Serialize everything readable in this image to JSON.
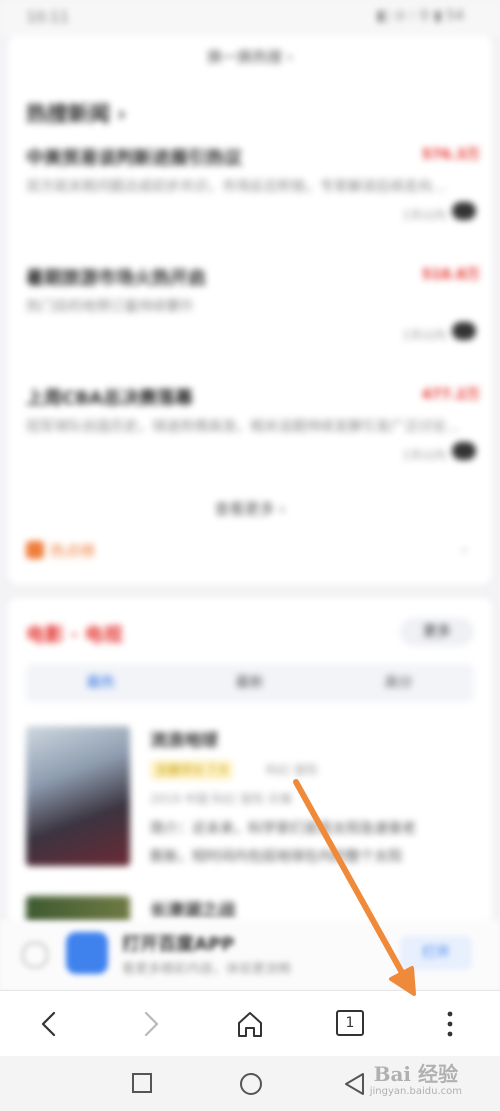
{
  "status": {
    "time": "10:11",
    "right": "◧ ⊙ ⁝ ⚲ ▮ 54"
  },
  "top_card": {
    "search_hint": "换一换热搜 ›",
    "section_title": "热搜新闻 ›",
    "news": [
      {
        "title": "中美贸易谈判新进展引热议",
        "hot": "576.3万",
        "desc": "双方就关税问题达成初步共识，市场反应积极，专家解读后续走向…",
        "meta": "1天以内"
      },
      {
        "title": "暑期旅游市场火热开启",
        "hot": "518.8万",
        "desc": "热门目的地预订量持续攀升",
        "meta": "1天以内"
      },
      {
        "title": "上周CBA总决赛落幕",
        "hot": "477.2万",
        "desc": "冠军球队创造历史，球迷热情高涨，相关话题持续发酵引发广泛讨论…",
        "meta": "1天以内"
      }
    ],
    "more_hint": "查看更多 ›",
    "tag_label": "热点榜"
  },
  "movie_card": {
    "head": "电影 · 电视",
    "more": "更多",
    "tabs": [
      "最热",
      "最新",
      "高分"
    ],
    "items": [
      {
        "title": "流浪地球",
        "badge": "豆瓣评分 7.9",
        "tags": "科幻  冒险",
        "info": "2019  中国    科幻    冒险    灾难",
        "line1": "简介：近未来，科学家们发现太阳急速衰老",
        "line2": "膨胀，短时间内包括地球在内的整个太阳"
      },
      {
        "title": "长津湖之战"
      }
    ]
  },
  "app_banner": {
    "title": "打开百度APP",
    "sub": "看更多精彩内容，体验更流畅",
    "button": "打开"
  },
  "toolbar": {
    "tab_count": "1"
  },
  "watermark": {
    "text": "Bai 经验",
    "url": "jingyan.baidu.com"
  },
  "colors": {
    "accent_red": "#e53935",
    "accent_orange": "#ee7d3a",
    "link_blue": "#2f6fe4",
    "annotation_arrow": "#ef8a3a"
  }
}
